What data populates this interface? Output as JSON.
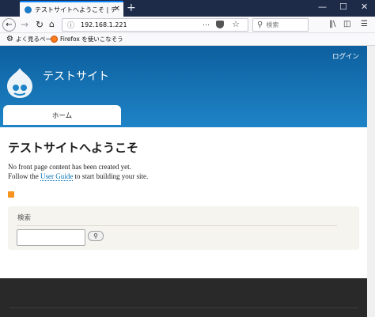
{
  "browser": {
    "tab_title": "テストサイトへようこそ | テストサイト",
    "tab_close_icon": "close-icon",
    "new_tab_label": "+",
    "window_minimize": "—",
    "window_maximize": "☐",
    "window_close": "✕",
    "url": "192.168.1.221",
    "search_placeholder": "検索",
    "bookmarks": [
      {
        "label": "よく見るページ",
        "icon": "gear-icon"
      },
      {
        "label": "Firefox を使いこなそう",
        "icon": "firefox-icon"
      }
    ]
  },
  "site": {
    "login_label": "ログイン",
    "name": "テストサイト",
    "nav": {
      "home_label": "ホーム"
    }
  },
  "content": {
    "title": "テストサイトへようこそ",
    "line1": "No front page content has been created yet.",
    "line2_before": "Follow the ",
    "line2_link": "User Guide",
    "line2_after": " to start building your site."
  },
  "search_block": {
    "label": "検索",
    "input_value": "",
    "button_icon": "magnifier-icon"
  },
  "colors": {
    "header_dark": "#0d5f9e",
    "header_light": "#1e84c7",
    "link": "#0071b3",
    "footer": "#292929",
    "rss": "#f7931e"
  }
}
